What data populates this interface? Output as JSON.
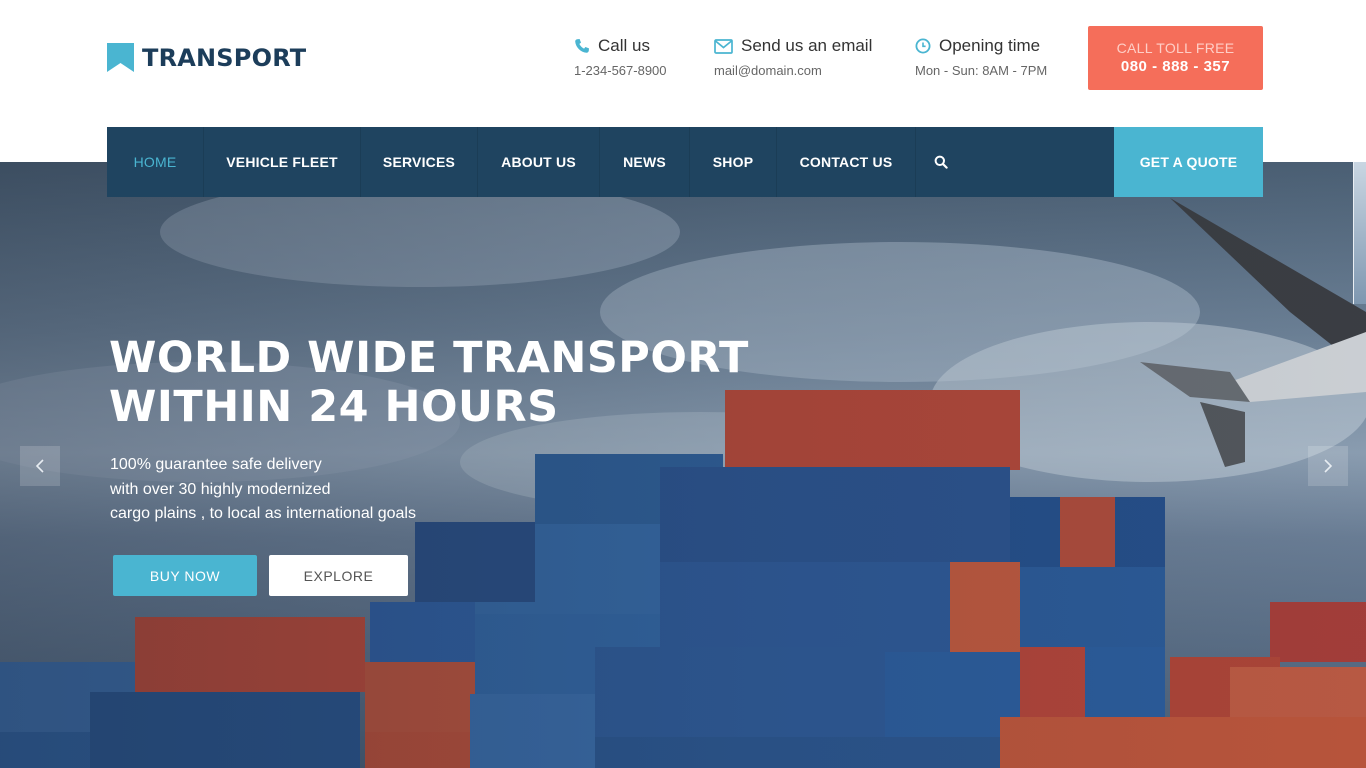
{
  "brand": {
    "name": "TRANSPORT"
  },
  "header": {
    "call": {
      "title": "Call us",
      "value": "1-234-567-8900",
      "icon": "phone-icon"
    },
    "email": {
      "title": "Send us an email",
      "value": "mail@domain.com",
      "icon": "envelope-icon"
    },
    "hours": {
      "title": "Opening time",
      "value": "Mon - Sun: 8AM - 7PM",
      "icon": "clock-icon"
    },
    "toll_free": {
      "label": "CALL TOLL FREE",
      "number": "080 - 888 - 357"
    }
  },
  "nav": {
    "items": [
      {
        "label": "HOME",
        "active": true
      },
      {
        "label": "VEHICLE FLEET"
      },
      {
        "label": "SERVICES"
      },
      {
        "label": "ABOUT US"
      },
      {
        "label": "NEWS"
      },
      {
        "label": "SHOP"
      },
      {
        "label": "CONTACT US"
      }
    ],
    "search_icon": "search-icon",
    "quote_label": "GET A QUOTE"
  },
  "hero": {
    "title_line1": "WORLD WIDE TRANSPORT",
    "title_line2": "WITHIN 24 HOURS",
    "text_line1": "100% guarantee safe delivery",
    "text_line2": "with over 30 highly modernized",
    "text_line3": "cargo plains , to local as international goals",
    "buy_label": "BUY NOW",
    "explore_label": "EXPLORE"
  },
  "colors": {
    "accent": "#4ab5d1",
    "navy": "#1f4460",
    "brand_text": "#1c3d5a",
    "coral": "#f56e5a"
  }
}
